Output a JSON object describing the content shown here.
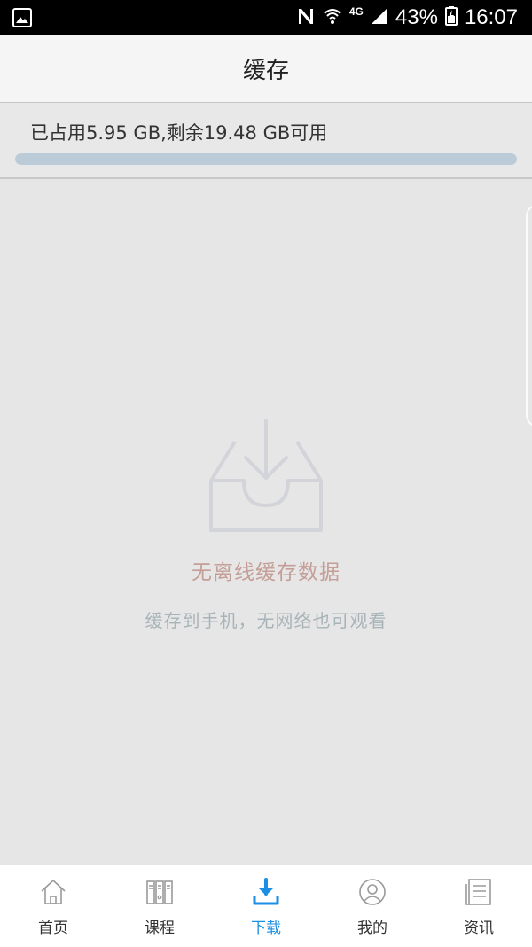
{
  "status_bar": {
    "network": "4G",
    "battery": "43%",
    "time": "16:07"
  },
  "header": {
    "title": "缓存"
  },
  "storage": {
    "summary": "已占用5.95 GB,剩余19.48 GB可用",
    "used_fraction": 1.0
  },
  "empty_state": {
    "icon": "inbox-download-icon",
    "title": "无离线缓存数据",
    "subtitle": "缓存到手机，无网络也可观看"
  },
  "tabs": [
    {
      "label": "首页",
      "icon": "home-icon",
      "active": false
    },
    {
      "label": "课程",
      "icon": "books-icon",
      "active": false
    },
    {
      "label": "下载",
      "icon": "download-icon",
      "active": true
    },
    {
      "label": "我的",
      "icon": "user-icon",
      "active": false
    },
    {
      "label": "资讯",
      "icon": "news-icon",
      "active": false
    }
  ],
  "colors": {
    "active_tab": "#1b8fe3",
    "empty_title": "#c49e97",
    "empty_subtitle": "#a8b4b8",
    "storage_bar": "#bccbd8"
  }
}
